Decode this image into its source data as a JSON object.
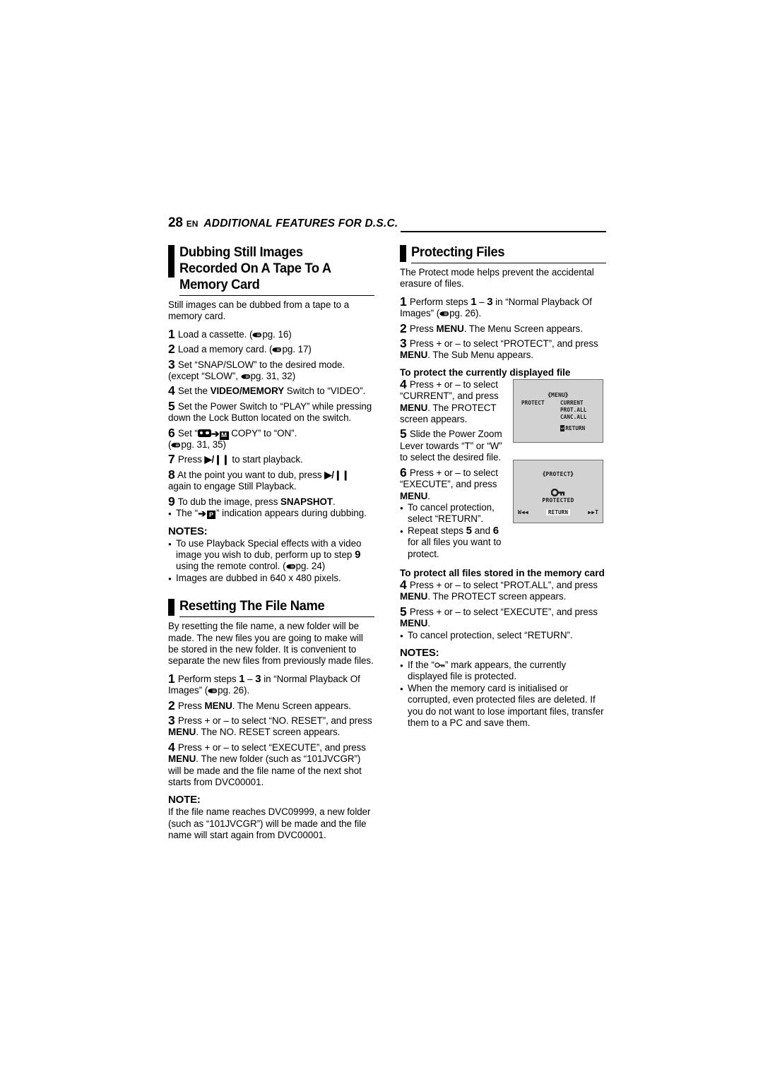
{
  "header": {
    "page_number": "28",
    "lang": "EN",
    "chapter": "ADDITIONAL FEATURES FOR D.S.C."
  },
  "left_column": {
    "section1": {
      "heading": "Dubbing Still Images Recorded On A Tape To A Memory Card",
      "intro": "Still images can be dubbed from a tape to a memory card.",
      "steps": [
        {
          "n": "1",
          "text": "Load a cassette. (",
          "ref": "pg. 16)"
        },
        {
          "n": "2",
          "text": "Load a memory card. (",
          "ref": "pg. 17)"
        },
        {
          "n": "3",
          "text": "Set “SNAP/SLOW” to the desired mode.",
          "cont": "(except “SLOW”, ",
          "cont_ref": "pg. 31, 32)"
        },
        {
          "n": "4",
          "text_a": "Set the ",
          "bold": "VIDEO/MEMORY",
          "text_b": " Switch to “VIDEO”."
        },
        {
          "n": "5",
          "text": "Set the Power Switch to “PLAY” while pressing down the Lock Button located on the switch."
        },
        {
          "n": "6",
          "text_a": "Set “",
          "icon_tape": "tape-icon",
          "icon_arrow": "➔",
          "icon_m": "M",
          "text_b": " COPY” to “ON”.",
          "cont": "(",
          "cont_ref": "pg. 31, 35)"
        },
        {
          "n": "7",
          "text_a": "Press ",
          "glyph": "▶/❙❙",
          "text_b": " to start playback."
        },
        {
          "n": "8",
          "text_a": "At the point you want to dub, press ",
          "glyph": "▶/❙❙",
          "text_b": " again to engage Still Playback."
        },
        {
          "n": "9",
          "text_a": "To dub the image, press ",
          "bold": "SNAPSHOT",
          "text_b": "."
        }
      ],
      "step9_bullet_a": "The “",
      "step9_bullet_arrow": "➔",
      "step9_bullet_icon": "P",
      "step9_bullet_b": "” indication appears during dubbing.",
      "notes_label": "NOTES:",
      "notes": [
        {
          "a": "To use Playback Special effects with a video image you wish to dub, perform up to step ",
          "n": "9",
          "b": " using the remote control. (",
          "ref": "pg. 24)"
        },
        {
          "a": "Images are dubbed in 640 x 480 pixels."
        }
      ]
    },
    "section2": {
      "heading": "Resetting The File Name",
      "intro": "By resetting the file name, a new folder will be made. The new files you are going to make will be stored in the new folder. It is convenient to separate the new files from previously made files.",
      "steps": [
        {
          "n": "1",
          "a": "Perform steps ",
          "n1": "1",
          "dash": " – ",
          "n2": "3",
          "b": " in “Normal Playback Of Images” (",
          "ref": "pg. 26)."
        },
        {
          "n": "2",
          "a": "Press ",
          "bold": "MENU",
          "b": ". The Menu Screen appears."
        },
        {
          "n": "3",
          "a": "Press + or – to select “NO. RESET”, and press ",
          "bold": "MENU",
          "b": ". The NO. RESET screen appears."
        },
        {
          "n": "4",
          "a": "Press + or – to select “EXECUTE”, and press ",
          "bold": "MENU",
          "b": ". The new folder (such as “101JVCGR”) will be made and the file name of the next shot starts from DVC00001."
        }
      ],
      "note_label": "NOTE:",
      "note_text": "If the file name reaches DVC09999, a new folder (such as “101JVCGR”) will be made and the file name will start again from DVC00001."
    }
  },
  "right_column": {
    "section1": {
      "heading": "Protecting Files",
      "intro": "The Protect mode helps prevent the accidental erasure of files.",
      "steps": [
        {
          "n": "1",
          "a": "Perform steps ",
          "n1": "1",
          "dash": " – ",
          "n2": "3",
          "b": " in “Normal Playback Of Images” (",
          "ref": "pg. 26)."
        },
        {
          "n": "2",
          "a": "Press ",
          "bold": "MENU",
          "b": ". The Menu Screen appears."
        },
        {
          "n": "3",
          "a": "Press + or – to select “PROTECT”, and press ",
          "bold": "MENU",
          "b": ". The Sub Menu appears."
        }
      ],
      "sub_heading_1": "To protect the currently displayed file",
      "steps_current": [
        {
          "n": "4",
          "a": "Press + or – to select “CURRENT”, and press ",
          "bold": "MENU",
          "b": ". The PROTECT screen appears."
        },
        {
          "n": "5",
          "a": "Slide the Power Zoom Lever towards “T” or “W” to select the desired file."
        },
        {
          "n": "6",
          "a": "Press + or – to select “EXECUTE”, and press ",
          "bold": "MENU",
          "b": "."
        }
      ],
      "bullets_current": [
        {
          "a": "To cancel protection, select “RETURN”."
        },
        {
          "a": "Repeat steps ",
          "n1": "5",
          "mid": " and ",
          "n2": "6",
          "b": " for all files you want to protect."
        }
      ],
      "sub_heading_2": "To protect all files stored in the memory card",
      "steps_all": [
        {
          "n": "4",
          "a": "Press + or – to select “PROT.ALL”, and press ",
          "bold": "MENU",
          "b": ". The PROTECT screen appears."
        },
        {
          "n": "5",
          "a": "Press + or – to select “EXECUTE”, and press ",
          "bold": "MENU",
          "b": "."
        }
      ],
      "bullets_all": [
        {
          "a": "To cancel protection, select “RETURN”."
        }
      ],
      "notes_label": "NOTES:",
      "notes": [
        {
          "a": "If the “",
          "icon": "key-icon",
          "b": "” mark appears, the currently displayed file is protected."
        },
        {
          "a": "When the memory card is initialised or corrupted, even protected files are deleted. If you do not want to lose important files, transfer them to a PC and save them."
        }
      ],
      "lcd_menu": {
        "title": "《MENU》",
        "left_label": "PROTECT",
        "options": [
          "CURRENT",
          "PROT.ALL",
          "CANC.ALL"
        ],
        "return_key": "↵",
        "return_label": "RETURN"
      },
      "lcd_protect": {
        "title": "《PROTECT》",
        "icon": "key-icon",
        "status": "PROTECTED",
        "left_control": "W◀◀",
        "center_control": "RETURN",
        "right_control": "▶▶T"
      }
    }
  },
  "colors": {
    "text": "#000000",
    "lcd_background": "#d2d2d2",
    "lcd_border": "#6d6d6d",
    "lcd_highlight": "#f2f2f2"
  }
}
